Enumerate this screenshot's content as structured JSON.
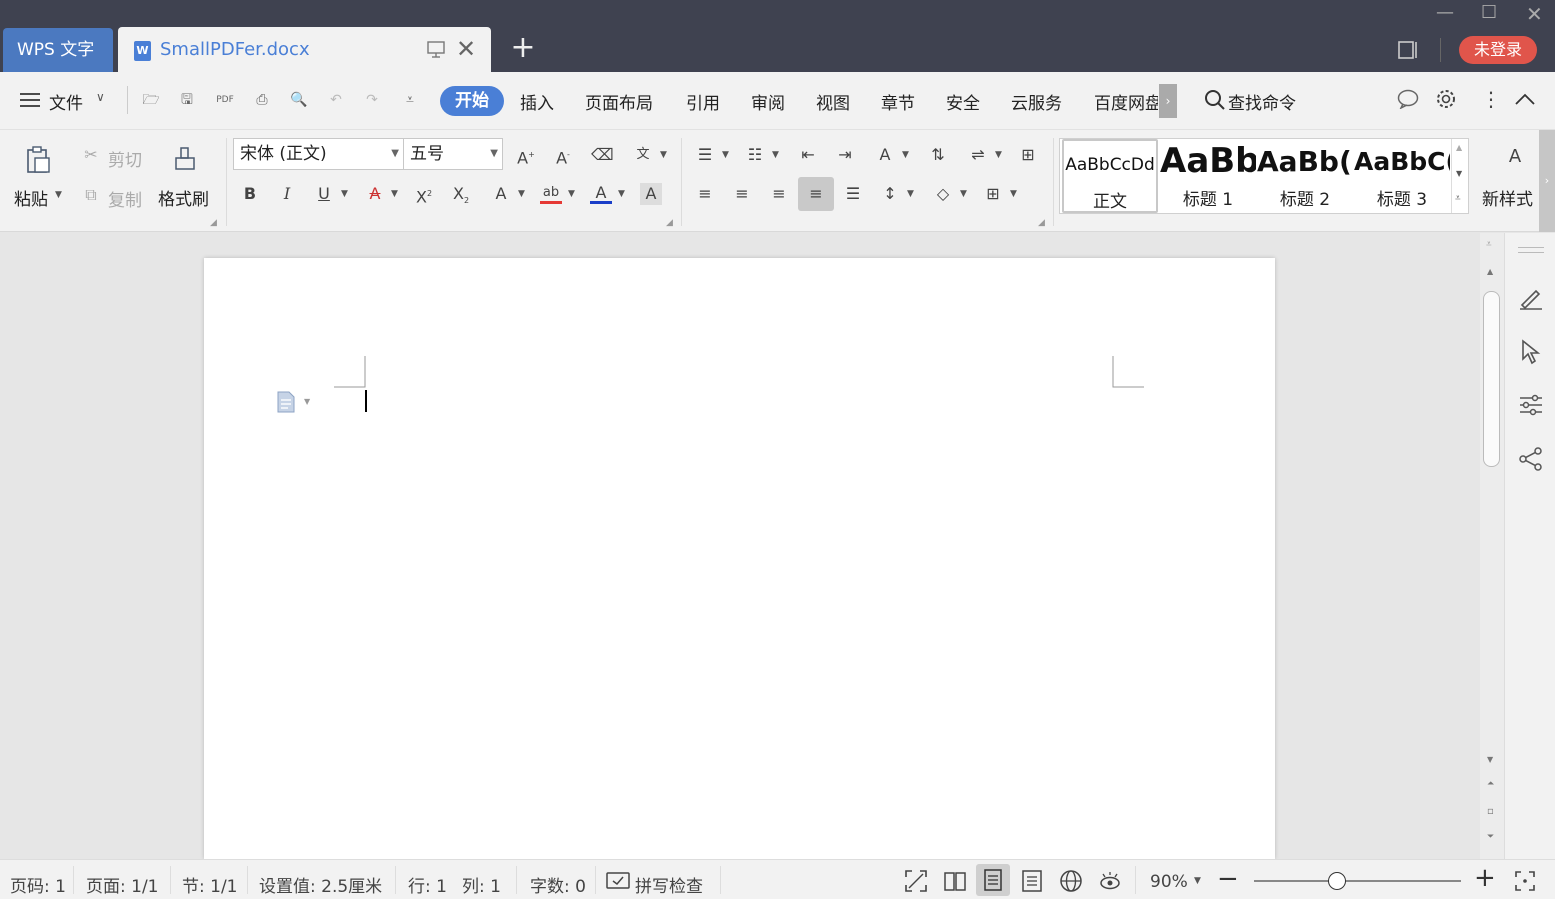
{
  "titlebar": {
    "app_tab": "WPS 文字",
    "doc_tab": "SmallPDFer.docx",
    "login_label": "未登录",
    "accent": "#4a7fd6",
    "login_color": "#e0554b"
  },
  "menubar": {
    "file_label": "文件",
    "tabs": [
      "开始",
      "插入",
      "页面布局",
      "引用",
      "审阅",
      "视图",
      "章节",
      "安全",
      "云服务",
      "百度网盘"
    ],
    "search_label": "查找命令"
  },
  "ribbon": {
    "paste": "粘贴",
    "cut": "剪切",
    "copy": "复制",
    "format_painter": "格式刷",
    "font_name": "宋体 (正文)",
    "font_size": "五号",
    "styles": [
      {
        "sample": "AaBbCcDd",
        "name": "正文"
      },
      {
        "sample": "AaBb",
        "name": "标题 1"
      },
      {
        "sample": "AaBb(",
        "name": "标题 2"
      },
      {
        "sample": "AaBbC(",
        "name": "标题 3"
      }
    ],
    "new_style": "新样式"
  },
  "status": {
    "page_code": "页码: 1",
    "page": "页面: 1/1",
    "section": "节: 1/1",
    "setting": "设置值: 2.5厘米",
    "row": "行: 1",
    "col": "列: 1",
    "word_count": "字数: 0",
    "spell_check": "拼写检查",
    "zoom": "90%",
    "zoom_fraction": 0.4
  }
}
